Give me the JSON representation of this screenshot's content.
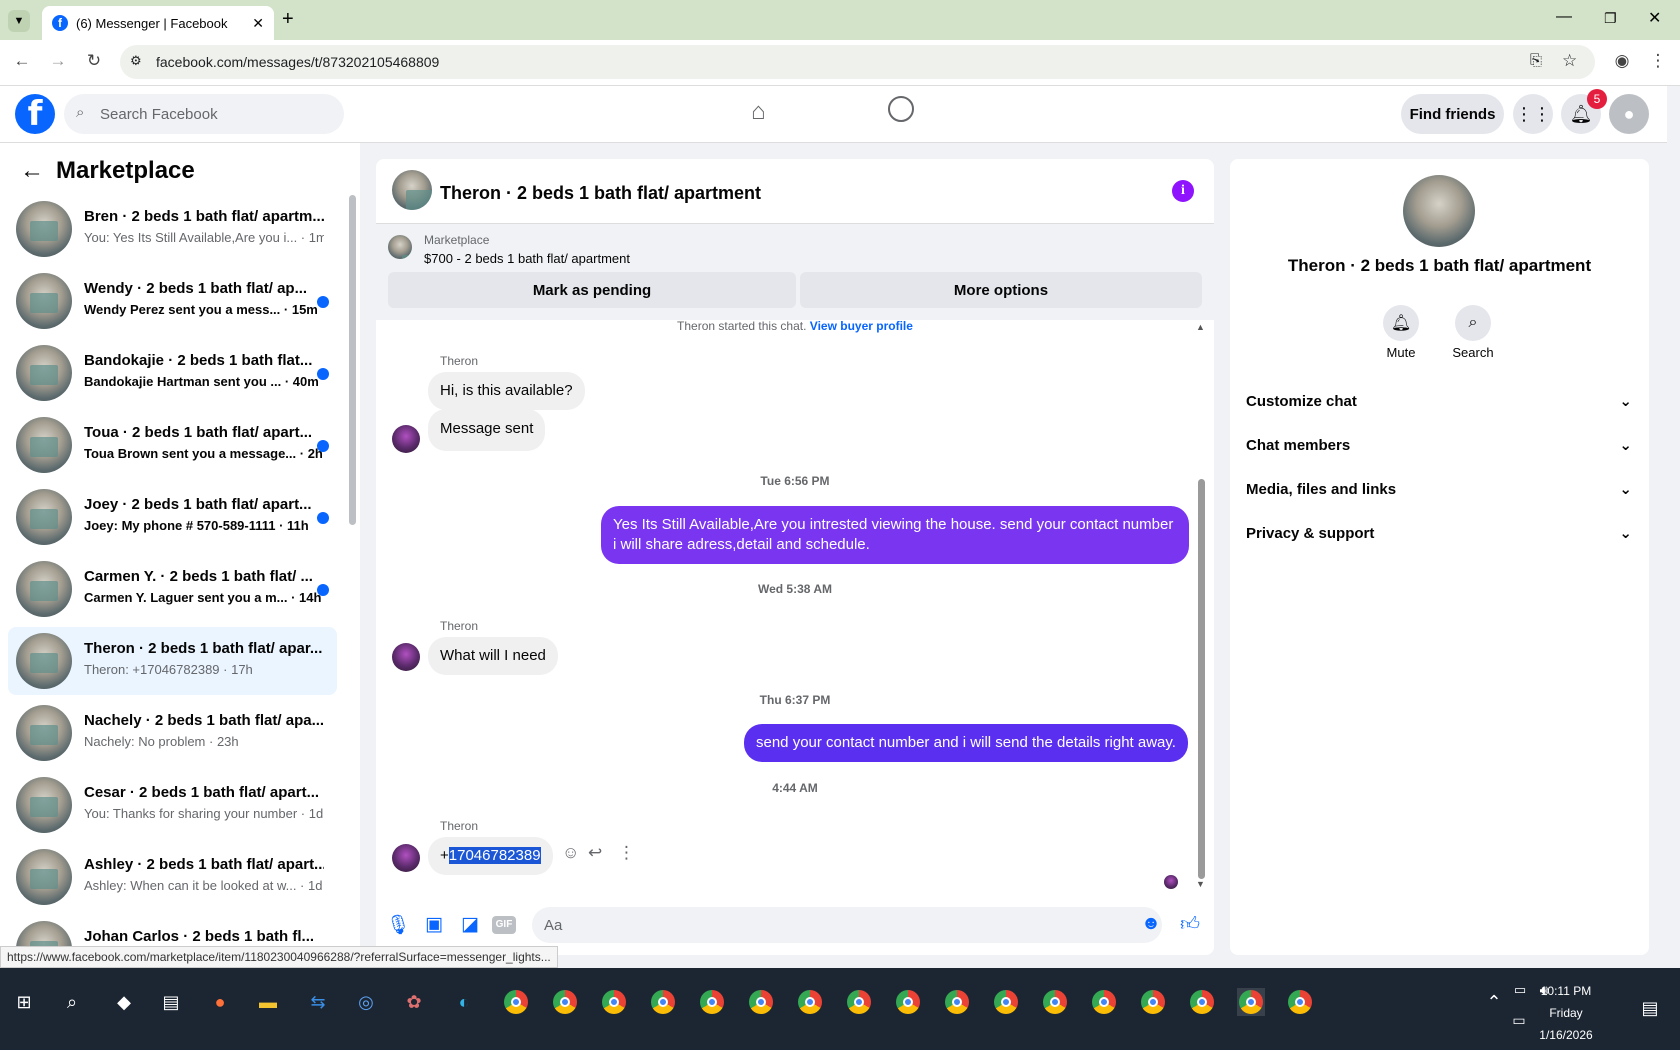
{
  "browser": {
    "tab_title": "(6) Messenger | Facebook",
    "url": "facebook.com/messages/t/873202105468809",
    "status_url": "https://www.facebook.com/marketplace/item/1180230040966288/?referralSurface=messenger_lights..."
  },
  "header": {
    "search_placeholder": "Search Facebook",
    "find_friends": "Find friends",
    "notification_count": "5"
  },
  "sidebar": {
    "title": "Marketplace",
    "conversations": [
      {
        "title": "Bren · 2 beds 1 bath flat/ apartm...",
        "subtitle": "You: Yes Its Still Available,Are you i... · 1m",
        "unread": false
      },
      {
        "title": "Wendy · 2 beds 1 bath flat/ ap...",
        "subtitle": "Wendy Perez sent you a mess... · 15m",
        "unread": true
      },
      {
        "title": "Bandokajie · 2 beds 1 bath flat...",
        "subtitle": "Bandokajie Hartman sent you ... · 40m",
        "unread": true
      },
      {
        "title": "Toua · 2 beds 1 bath flat/ apart...",
        "subtitle": "Toua Brown sent you a message... · 2h",
        "unread": true
      },
      {
        "title": "Joey · 2 beds 1 bath flat/ apart...",
        "subtitle": "Joey: My phone # 570-589-1111 · 11h",
        "unread": true
      },
      {
        "title": "Carmen Y. · 2 beds 1 bath flat/ ...",
        "subtitle": "Carmen Y. Laguer sent you a m... · 14h",
        "unread": true
      },
      {
        "title": "Theron · 2 beds 1 bath flat/ apar...",
        "subtitle": "Theron: +17046782389 · 17h",
        "unread": false,
        "active": true
      },
      {
        "title": "Nachely · 2 beds 1 bath flat/ apa...",
        "subtitle": "Nachely: No problem · 23h",
        "unread": false
      },
      {
        "title": "Cesar · 2 beds 1 bath flat/ apart...",
        "subtitle": "You: Thanks for sharing your number · 1d",
        "unread": false
      },
      {
        "title": "Ashley · 2 beds 1 bath flat/ apart...",
        "subtitle": "Ashley: When can it be looked at w... · 1d",
        "unread": false
      },
      {
        "title": "Johan Carlos · 2 beds 1 bath fl...",
        "subtitle": "",
        "unread": false
      }
    ]
  },
  "chat": {
    "title": "Theron · 2 beds 1 bath flat/ apartment",
    "listing_source": "Marketplace",
    "listing_price_title": "$700 - 2 beds 1 bath flat/ apartment",
    "mark_pending": "Mark as pending",
    "more_options": "More options",
    "started_text": "Theron started this chat.",
    "view_buyer": "View buyer profile",
    "sender_name": "Theron",
    "msg1": "Hi, is this available?",
    "msg2": "Message sent",
    "ts1": "Tue 6:56 PM",
    "msg3": "Yes Its Still Available,Are you intrested viewing the house. send your contact number i will share adress,detail and schedule.",
    "ts2": "Wed 5:38 AM",
    "msg4": "What will I need",
    "ts3": "Thu 6:37 PM",
    "msg5": "send your contact number and i will send the details right away.",
    "ts4": "4:44 AM",
    "msg6_prefix": "+",
    "msg6_selected": "17046782389",
    "composer_placeholder": "Aa",
    "gif_label": "GIF"
  },
  "details": {
    "title": "Theron · 2 beds 1 bath flat/ apartment",
    "mute": "Mute",
    "search": "Search",
    "rows": [
      "Customize chat",
      "Chat members",
      "Media, files and links",
      "Privacy & support"
    ]
  },
  "taskbar": {
    "time": "10:11 PM",
    "day": "Friday",
    "date": "1/16/2026"
  },
  "colors": {
    "accent": "#0866ff",
    "outgoing": "#7a35f0",
    "notif": "#e41e3f"
  }
}
